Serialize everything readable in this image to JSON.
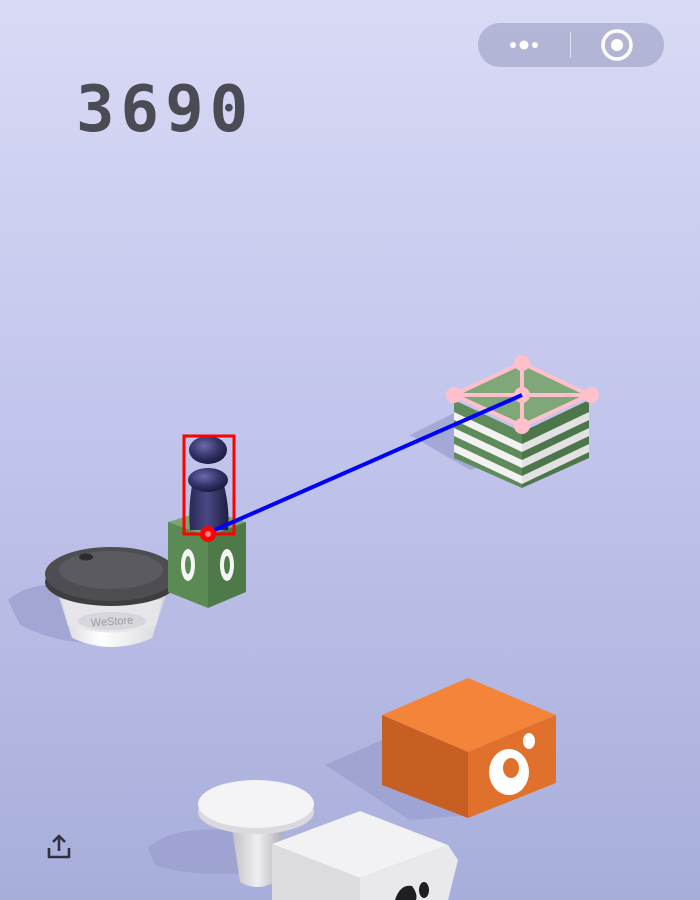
{
  "game": {
    "score": "3690"
  },
  "capsule": {
    "more_icon": "more-dots-icon",
    "close_icon": "target-circle-icon"
  },
  "cup": {
    "brand_text": "WeStore"
  },
  "share": {
    "icon": "share-upload-icon"
  },
  "colors": {
    "background_top": "#d9daf5",
    "background_bottom": "#a8aedb",
    "score_text": "#4a4b55",
    "green_block": "#5f8a5c",
    "orange_block": "#f08238",
    "player_bbox": "#ff0000",
    "aim_line": "#0000ff",
    "target_marker": "#ffc0cb"
  }
}
